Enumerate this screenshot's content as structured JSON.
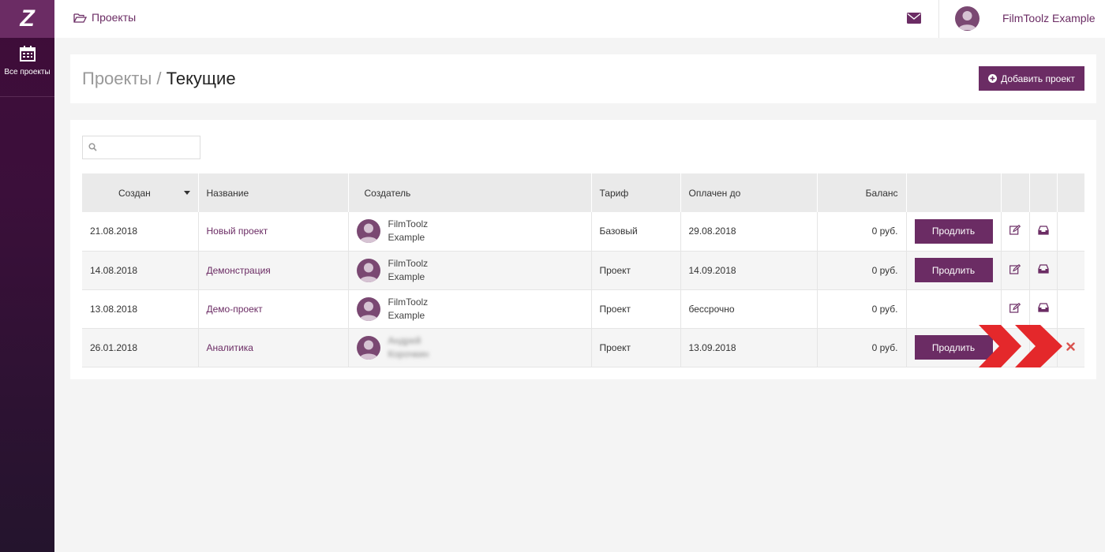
{
  "sidebar": {
    "logo": "Z",
    "nav_label": "Все проекты"
  },
  "topbar": {
    "breadcrumb": "Проекты",
    "username": "FilmToolz Example"
  },
  "header": {
    "title_parent": "Проекты",
    "title_sep": " / ",
    "title_current": "Текущие",
    "add_label": "Добавить проект"
  },
  "search": {
    "placeholder": "",
    "value": ""
  },
  "table": {
    "headers": [
      "Создан",
      "Название",
      "Создатель",
      "Тариф",
      "Оплачен до",
      "Баланс"
    ],
    "rows": [
      {
        "created": "21.08.2018",
        "name": "Новый проект",
        "creator_first": "FilmToolz",
        "creator_last": "Example",
        "tariff": "Базовый",
        "paid_until": "29.08.2018",
        "balance": "0 руб.",
        "action": "Продлить"
      },
      {
        "created": "14.08.2018",
        "name": "Демонстрация",
        "creator_first": "FilmToolz",
        "creator_last": "Example",
        "tariff": "Проект",
        "paid_until": "14.09.2018",
        "balance": "0 руб.",
        "action": "Продлить"
      },
      {
        "created": "13.08.2018",
        "name": "Демо-проект",
        "creator_first": "FilmToolz",
        "creator_last": "Example",
        "tariff": "Проект",
        "paid_until": "бессрочно",
        "balance": "0 руб.",
        "action": ""
      },
      {
        "created": "26.01.2018",
        "name": "Аналитика",
        "creator_first": "Андрей",
        "creator_last": "Корочкин",
        "tariff": "Проект",
        "paid_until": "13.09.2018",
        "balance": "0 руб.",
        "action": "Продлить"
      }
    ]
  },
  "colors": {
    "accent": "#6b2c64",
    "sidebar": "#3f0c39",
    "arrow": "#e4282b"
  }
}
